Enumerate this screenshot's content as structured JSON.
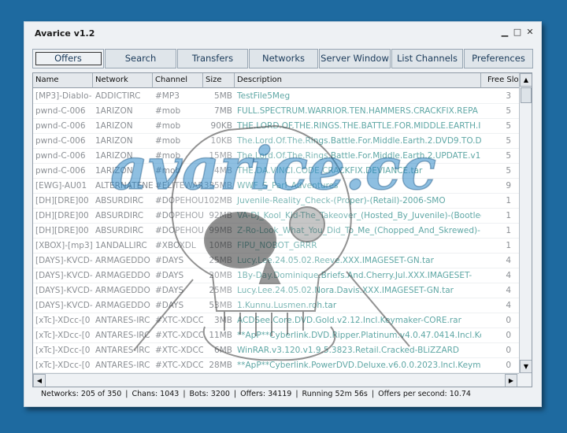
{
  "window": {
    "title": "Avarice v1.2",
    "minimize": "▁",
    "maximize": "□",
    "close": "✕"
  },
  "tabs": [
    {
      "label": "Offers",
      "active": true
    },
    {
      "label": "Search"
    },
    {
      "label": "Transfers"
    },
    {
      "label": "Networks"
    },
    {
      "label": "Server Window"
    },
    {
      "label": "List Channels"
    },
    {
      "label": "Preferences"
    }
  ],
  "table": {
    "columns": [
      "Name",
      "Network",
      "Channel",
      "Size",
      "Description",
      "Free Slo"
    ],
    "rows": [
      [
        "[MP3]-Diablo-",
        "ADDICTIRC",
        "#MP3",
        "5MB",
        "TestFile5Meg",
        "3"
      ],
      [
        "pwnd-C-006",
        "1ARIZON",
        "#mob",
        "7MB",
        "FULL.SPECTRUM.WARRIOR.TEN.HAMMERS.CRACKFIX.REPA",
        "5"
      ],
      [
        "pwnd-C-006",
        "1ARIZON",
        "#mob",
        "90KB",
        "THE.LORD.OF.THE.RINGS.THE.BATTLE.FOR.MIDDLE.EARTH.II",
        "5"
      ],
      [
        "pwnd-C-006",
        "1ARIZON",
        "#mob",
        "10KB",
        "The.Lord.Of.The.Rings.Battle.For.Middle.Earth.2.DVD9.TO.DV",
        "5"
      ],
      [
        "pwnd-C-006",
        "1ARIZON",
        "#mob",
        "15MB",
        "The.Lord.Of.The.Rings.Battle.For.Middle.Earth.2.UPDATE.v1.1-",
        "5"
      ],
      [
        "pwnd-C-006",
        "1ARIZON",
        "#mob",
        "4MB",
        "THE.DA.VINCI.CODE.CRACKFIX.DEVIANCE.tar",
        "5"
      ],
      [
        "[EWG]-AU01",
        "ALTERNATENE",
        "#ELITEWAR",
        "335MB",
        "WWF_S_Parl_Adventures",
        "9"
      ],
      [
        "[DH][DRE]00",
        "ABSURDIRC",
        "#DOPEHOU",
        "102MB",
        "Juvenile-Reality_Check-(Proper)-(Retail)-2006-SMO",
        "1"
      ],
      [
        "[DH][DRE]00",
        "ABSURDIRC",
        "#DOPEHOU",
        "92MB",
        "VA-DJ_Kool_Kid-The_Takeover_(Hosted_By_Juvenile)-(Bootleg",
        "1"
      ],
      [
        "[DH][DRE]00",
        "ABSURDIRC",
        "#DOPEHOU",
        "99MB",
        "Z-Ro-Look_What_You_Did_To_Me_(Chopped_And_Skrewed)-",
        "1"
      ],
      [
        "[XBOX]-[mp3]-",
        "1ANDALLIRC",
        "#XBOXDL",
        "10MB",
        "FIPU_NOBOT_GRRR",
        "1"
      ],
      [
        "[DAYS]-KVCD-",
        "ARMAGEDDO",
        "#DAYS",
        "25MB",
        "Lucy.Lee.24.05.02.Reeve.XXX.IMAGESET-GN.tar",
        "4"
      ],
      [
        "[DAYS]-KVCD-",
        "ARMAGEDDO",
        "#DAYS",
        "20MB",
        "1By-Day.Dominique.Briefs.And.Cherry.Jul.XXX.IMAGESET-",
        "4"
      ],
      [
        "[DAYS]-KVCD-",
        "ARMAGEDDO",
        "#DAYS",
        "25MB",
        "Lucy.Lee.24.05.02.Nora.Davis.XXX.IMAGESET-GN.tar",
        "4"
      ],
      [
        "[DAYS]-KVCD-",
        "ARMAGEDDO",
        "#DAYS",
        "53MB",
        "1.Kunnu.Lusmen.roh.tar",
        "4"
      ],
      [
        "[xTc]-XDcc-[0",
        "ANTARES-IRC",
        "#XTC-XDCC",
        "3MB",
        "ACDSee.Core.DVD.Gold.v2.12.Incl.Keymaker-CORE.rar",
        "0"
      ],
      [
        "[xTc]-XDcc-[0",
        "ANTARES-IRC",
        "#XTC-XDCC",
        "11MB",
        "**ApP**Cyberlink.DVD.Ripper.Platinum.v4.0.47.0414.Incl.Key",
        "0"
      ],
      [
        "[xTc]-XDcc-[0",
        "ANTARES-IRC",
        "#XTC-XDCC",
        "6MB",
        "WinRAR.v3.120.v1.9.5.3823.Retail.Cracked-BLiZZARD",
        "0"
      ],
      [
        "[xTc]-XDcc-[0",
        "ANTARES-IRC",
        "#XTC-XDCC",
        "28MB",
        "**ApP**Cyberlink.PowerDVD.Deluxe.v6.0.0.2023.Incl.Keym",
        "0"
      ]
    ]
  },
  "scroll": {
    "up": "▲",
    "down": "▼",
    "left": "◀",
    "right": "▶"
  },
  "status": {
    "networks": "Networks: 205 of 350",
    "chans": "Chans: 1043",
    "bots": "Bots: 3200",
    "offers": "Offers: 34119",
    "running": "Running 52m 56s",
    "rate": "Offers per second: 10.74"
  },
  "watermark": {
    "text": "avarice.cc",
    "color": "#1d7fc4"
  }
}
